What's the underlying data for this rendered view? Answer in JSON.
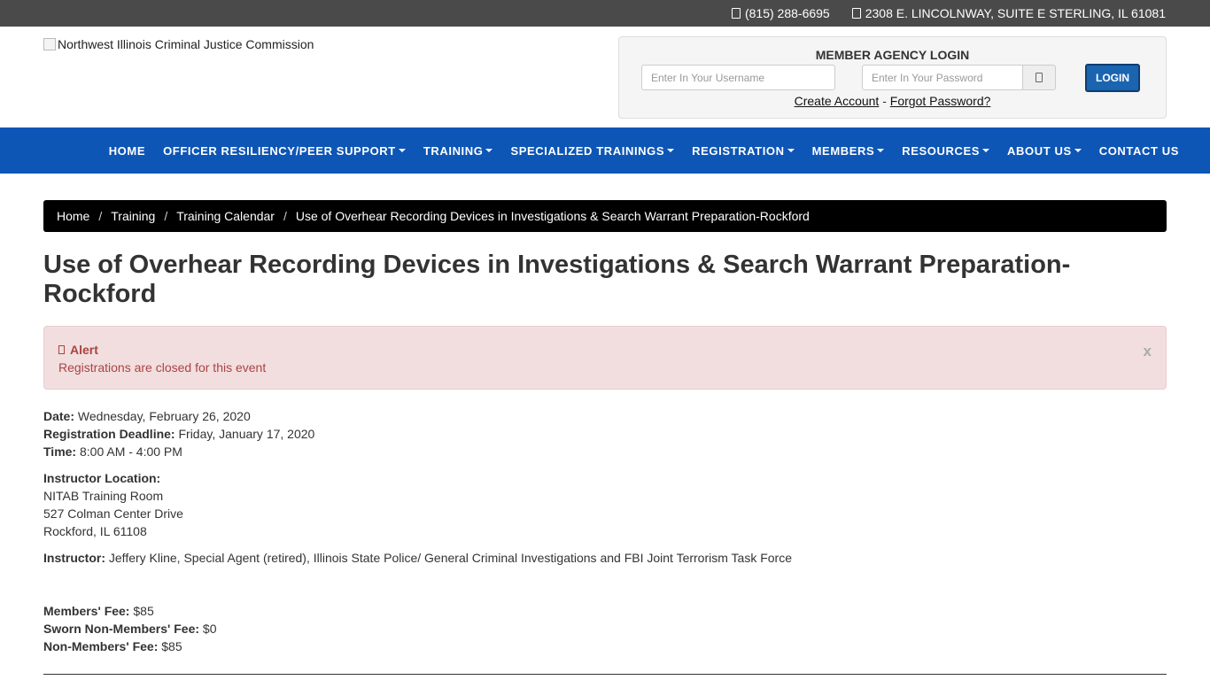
{
  "topbar": {
    "phone": "(815) 288-6695",
    "address": "2308 E. LINCOLNWAY, SUITE E STERLING, IL 61081"
  },
  "logo": {
    "alt": "Northwest Illinois Criminal Justice Commission"
  },
  "login": {
    "title": "MEMBER AGENCY LOGIN",
    "username_placeholder": "Enter In Your Username",
    "password_placeholder": "Enter In Your Password",
    "button": "LOGIN",
    "create_account": "Create Account",
    "separator": "-",
    "forgot_password": "Forgot Password?"
  },
  "nav": {
    "items": [
      {
        "label": "HOME",
        "dropdown": false
      },
      {
        "label": "OFFICER RESILIENCY/PEER SUPPORT",
        "dropdown": true
      },
      {
        "label": "TRAINING",
        "dropdown": true
      },
      {
        "label": "SPECIALIZED TRAININGS",
        "dropdown": true
      },
      {
        "label": "REGISTRATION",
        "dropdown": true
      },
      {
        "label": "MEMBERS",
        "dropdown": true
      },
      {
        "label": "RESOURCES",
        "dropdown": true
      },
      {
        "label": "ABOUT US",
        "dropdown": true
      },
      {
        "label": "CONTACT US",
        "dropdown": false
      }
    ]
  },
  "breadcrumb": {
    "items": [
      "Home",
      "Training",
      "Training Calendar",
      "Use of Overhear Recording Devices in Investigations & Search Warrant Preparation-Rockford"
    ],
    "separator": "/"
  },
  "page": {
    "title": "Use of Overhear Recording Devices in Investigations & Search Warrant Preparation-Rockford"
  },
  "alert": {
    "title": "Alert",
    "message": "Registrations are closed for this event",
    "close": "x"
  },
  "details": {
    "date_label": "Date:",
    "date": "Wednesday, February 26, 2020",
    "deadline_label": "Registration Deadline:",
    "deadline": "Friday, January 17, 2020",
    "time_label": "Time:",
    "time": "8:00 AM - 4:00 PM",
    "location_label": "Instructor Location:",
    "location_lines": [
      "NITAB Training Room",
      "527 Colman Center Drive",
      "Rockford, IL 61108"
    ],
    "instructor_label": "Instructor:",
    "instructor": "Jeffery Kline, Special Agent (retired), Illinois State Police/ General Criminal Investigations and FBI Joint Terrorism Task Force",
    "members_fee_label": "Members' Fee:",
    "members_fee": "$85",
    "sworn_fee_label": "Sworn Non-Members' Fee:",
    "sworn_fee": "$0",
    "non_members_fee_label": "Non-Members' Fee:",
    "non_members_fee": "$85"
  },
  "colors": {
    "topbar": "#4a4a4a",
    "nav": "#0d56b5",
    "login_button": "#1a64b0",
    "alert_bg": "#f2dede",
    "alert_text": "#a94442"
  }
}
